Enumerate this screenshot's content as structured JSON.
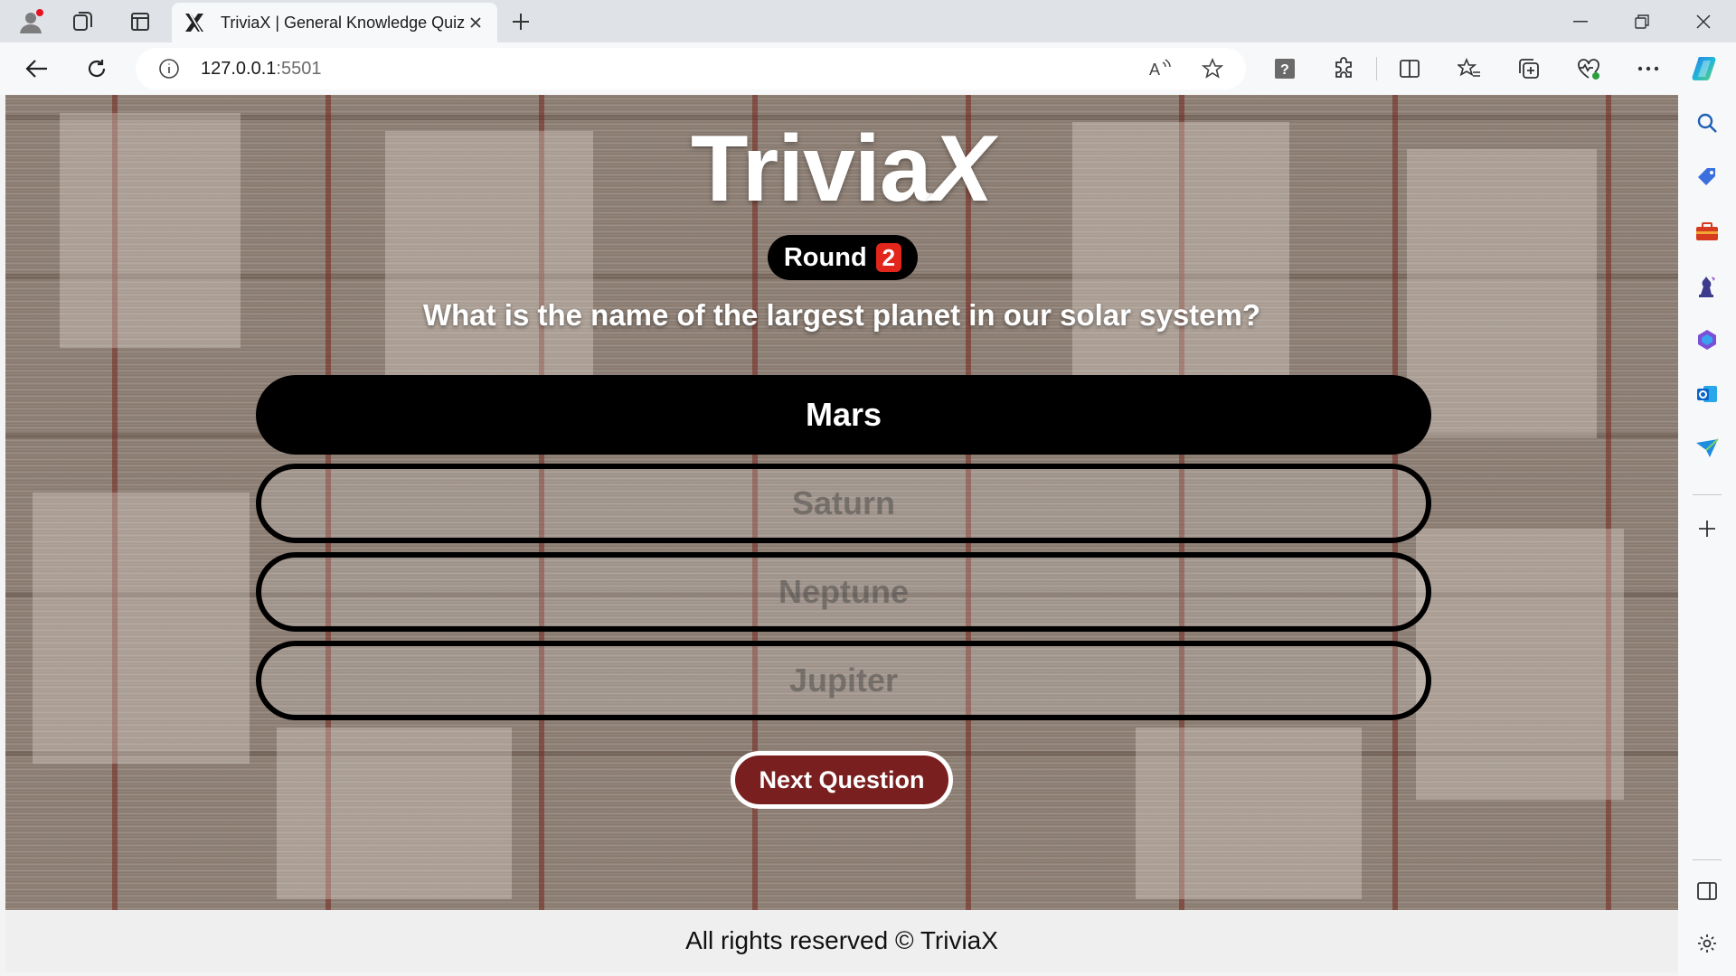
{
  "browser": {
    "tab": {
      "title": "TriviaX | General Knowledge Quiz",
      "favicon": "x-logo-icon"
    },
    "address": {
      "host": "127.0.0.1",
      "port": ":5501"
    },
    "icons": {
      "profile": "profile-avatar-icon",
      "workspaces": "workspaces-icon",
      "tab_actions": "tab-actions-icon",
      "back": "back-arrow-icon",
      "refresh": "refresh-icon",
      "site_info": "info-icon",
      "read_aloud": "read-aloud-icon",
      "favorite": "star-icon",
      "extension_help": "help-icon",
      "extensions": "puzzle-icon",
      "split_screen": "split-screen-icon",
      "favorites": "favorites-icon",
      "collections": "collections-icon",
      "performance": "heart-pulse-icon",
      "more": "more-icon",
      "copilot": "copilot-icon"
    },
    "sidebar_icons": [
      "search-icon",
      "tag-icon",
      "toolbox-icon",
      "chess-icon",
      "microsoft365-icon",
      "outlook-icon",
      "send-icon",
      "add-icon",
      "sidebar-toggle-icon",
      "settings-icon"
    ]
  },
  "page": {
    "logo": {
      "text": "Trivia",
      "mark": "X"
    },
    "round": {
      "label": "Round",
      "number": "2"
    },
    "question": "What is the name of the largest planet in our solar system?",
    "answers": [
      {
        "label": "Mars",
        "state": "selected"
      },
      {
        "label": "Saturn",
        "state": "disabled"
      },
      {
        "label": "Neptune",
        "state": "disabled"
      },
      {
        "label": "Jupiter",
        "state": "disabled"
      }
    ],
    "next_button": "Next Question",
    "footer": "All rights reserved © TriviaX"
  },
  "colors": {
    "round_badge": "#e3261c",
    "next_button": "#7a1f1f",
    "selected_answer": "#000000"
  }
}
